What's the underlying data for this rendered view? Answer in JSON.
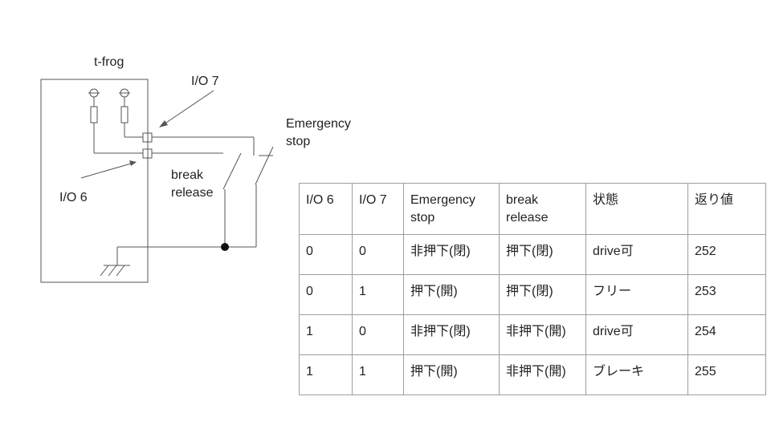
{
  "labels": {
    "device": "t-frog",
    "io7": "I/O 7",
    "io6": "I/O 6",
    "emergency_stop": "Emergency\nstop",
    "break_release": "break\nrelease"
  },
  "table": {
    "headers": [
      "I/O 6",
      "I/O 7",
      "Emergency\nstop",
      "break\nrelease",
      "状態",
      "返り値"
    ],
    "rows": [
      [
        "0",
        "0",
        "非押下(閉)",
        "押下(閉)",
        "drive可",
        "252"
      ],
      [
        "0",
        "1",
        "押下(開)",
        "押下(閉)",
        "フリー",
        "253"
      ],
      [
        "1",
        "0",
        "非押下(閉)",
        "非押下(開)",
        "drive可",
        "254"
      ],
      [
        "1",
        "1",
        "押下(開)",
        "非押下(開)",
        "ブレーキ",
        "255"
      ]
    ]
  },
  "colors": {
    "line": "#555555",
    "border": "#9e9e9e",
    "text": "#222222"
  }
}
